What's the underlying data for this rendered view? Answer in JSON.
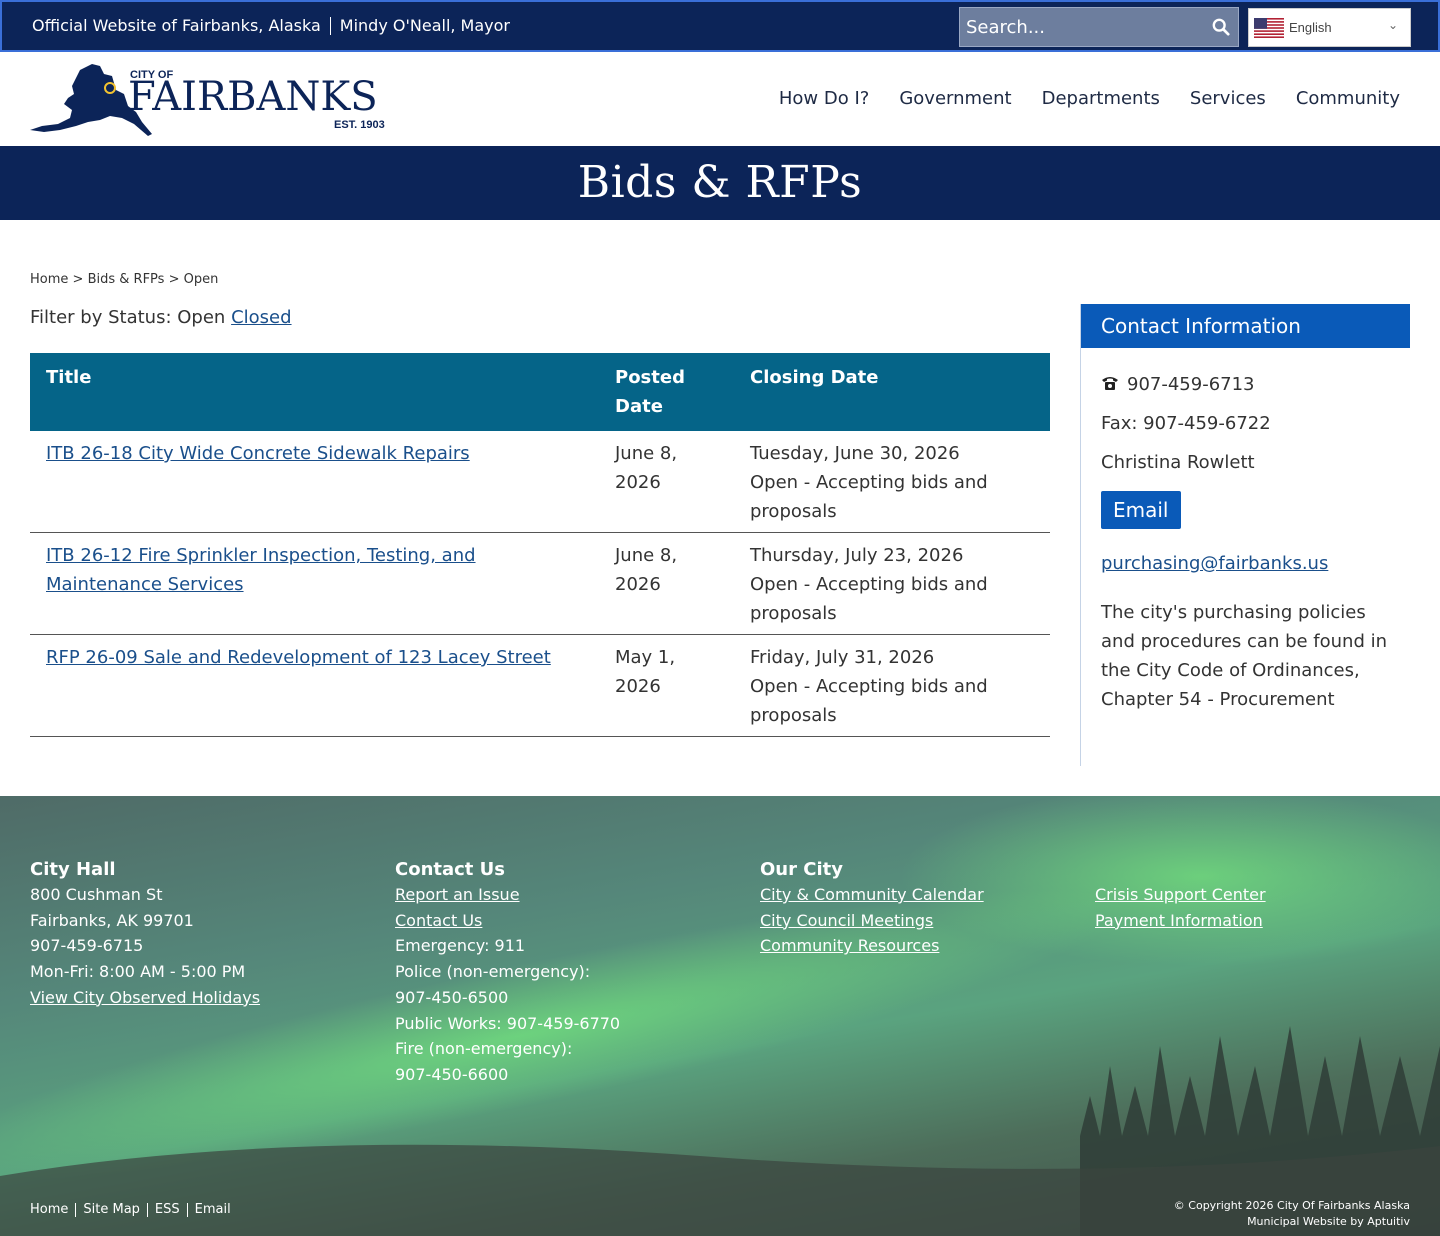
{
  "topbar": {
    "official_text": "Official Website of Fairbanks, Alaska",
    "mayor_text": "Mindy O'Neall, Mayor",
    "search_placeholder": "Search...",
    "language": "English"
  },
  "header": {
    "logo": {
      "city_of": "CITY OF",
      "name": "FAIRBANKS",
      "est": "EST. 1903"
    },
    "nav": [
      "How Do I?",
      "Government",
      "Departments",
      "Services",
      "Community"
    ]
  },
  "banner": {
    "title": "Bids & RFPs"
  },
  "breadcrumb": [
    "Home",
    "Bids & RFPs",
    "Open"
  ],
  "filter": {
    "label": "Filter by Status:",
    "current": "Open",
    "other": "Closed"
  },
  "table": {
    "headers": [
      "Title",
      "Posted Date",
      "Closing Date"
    ],
    "rows": [
      {
        "title": "ITB 26-18 City Wide Concrete Sidewalk Repairs",
        "posted": "June 8, 2026",
        "closing": "Tuesday, June 30, 2026",
        "status": "Open - Accepting bids and proposals"
      },
      {
        "title": "ITB 26-12 Fire Sprinkler Inspection, Testing, and Maintenance Services",
        "posted": "June 8, 2026",
        "closing": "Thursday, July 23, 2026",
        "status": "Open - Accepting bids and proposals"
      },
      {
        "title": "RFP 26-09 Sale and Redevelopment of 123 Lacey Street",
        "posted": "May 1, 2026",
        "closing": "Friday, July 31, 2026",
        "status": "Open - Accepting bids and proposals"
      }
    ]
  },
  "contact": {
    "heading": "Contact Information",
    "phone": "907-459-6713",
    "fax": "Fax: 907-459-6722",
    "name": "Christina Rowlett",
    "email_button": "Email",
    "email": "purchasing@fairbanks.us",
    "policy": "The city's purchasing policies and procedures can be found in the City Code of Ordinances, Chapter 54 - Procurement"
  },
  "footer": {
    "city_hall": {
      "heading": "City Hall",
      "address1": "800 Cushman St",
      "address2": "Fairbanks, AK 99701",
      "phone": "907-459-6715",
      "hours": "Mon-Fri: 8:00 AM - 5:00 PM",
      "holidays_link": "View City Observed Holidays"
    },
    "contact_us": {
      "heading": "Contact Us",
      "links": [
        "Report an Issue",
        "Contact Us"
      ],
      "emergency": "Emergency: 911",
      "police_label": "Police (non-emergency):",
      "police_phone": "907-450-6500",
      "public_works": "Public Works: 907-459-6770",
      "fire_label": "Fire (non-emergency):",
      "fire_phone": "907-450-6600"
    },
    "our_city": {
      "heading": "Our City",
      "links": [
        "City & Community Calendar",
        "City Council Meetings",
        "Community Resources"
      ]
    },
    "more_links": [
      "Crisis Support Center",
      "Payment Information"
    ],
    "bottom_links": [
      "Home",
      "Site Map",
      "ESS",
      "Email"
    ],
    "copyright": "© Copyright 2026 City Of Fairbanks Alaska",
    "credit": "Municipal Website by Aptuitiv"
  },
  "colors": {
    "navy": "#0c2458",
    "table_header": "#056488",
    "contact_blue": "#0a5ab8",
    "link": "#1a4f8b"
  }
}
